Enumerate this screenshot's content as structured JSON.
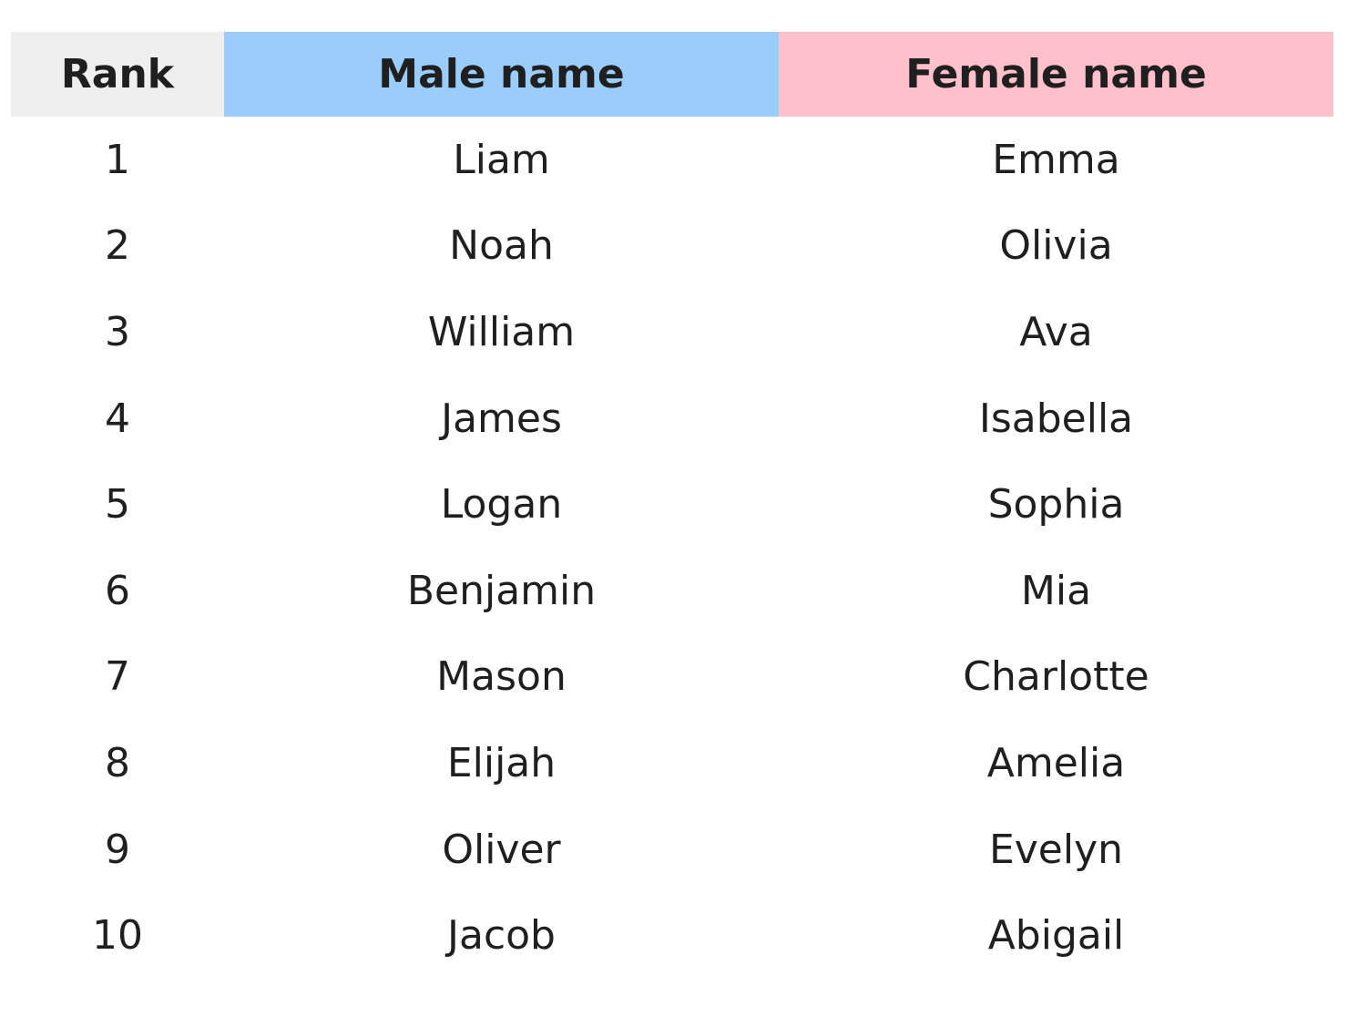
{
  "table": {
    "headers": {
      "rank": "Rank",
      "male": "Male name",
      "female": "Female name"
    },
    "header_colors": {
      "rank": "#efefef",
      "male": "#9bcdfb",
      "female": "#fec1cb"
    },
    "rows": [
      {
        "rank": "1",
        "male": "Liam",
        "female": "Emma"
      },
      {
        "rank": "2",
        "male": "Noah",
        "female": "Olivia"
      },
      {
        "rank": "3",
        "male": "William",
        "female": "Ava"
      },
      {
        "rank": "4",
        "male": "James",
        "female": "Isabella"
      },
      {
        "rank": "5",
        "male": "Logan",
        "female": "Sophia"
      },
      {
        "rank": "6",
        "male": "Benjamin",
        "female": "Mia"
      },
      {
        "rank": "7",
        "male": "Mason",
        "female": "Charlotte"
      },
      {
        "rank": "8",
        "male": "Elijah",
        "female": "Amelia"
      },
      {
        "rank": "9",
        "male": "Oliver",
        "female": "Evelyn"
      },
      {
        "rank": "10",
        "male": "Jacob",
        "female": "Abigail"
      }
    ]
  }
}
